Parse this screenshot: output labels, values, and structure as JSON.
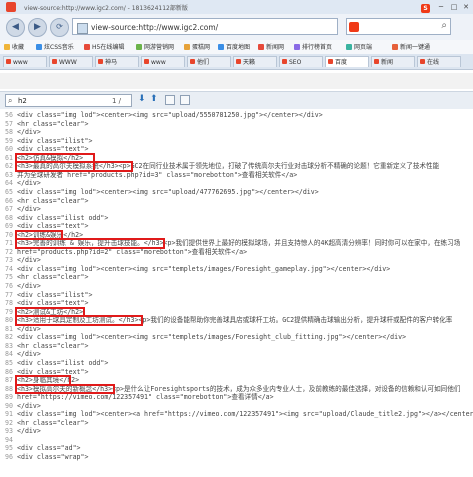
{
  "titlebar": {
    "title": "view-source:http://www.igc2.com/ - 1813624112部新版",
    "logo": "browser-logo-icon",
    "right_logo_text": "S",
    "window_buttons": [
      "─",
      "□",
      "✕"
    ]
  },
  "navbar": {
    "back": "◀",
    "forward": "▶",
    "address": "view-source:http://www.igc2.com/",
    "search_value": ""
  },
  "bookmarks": [
    {
      "label": "收藏",
      "color": "#f0b53a"
    },
    {
      "label": "炫CSS音乐",
      "color": "#3a8ee6"
    },
    {
      "label": "H5在线编辑",
      "color": "#e64a3a"
    },
    {
      "label": "网游营销网",
      "color": "#6bb34b"
    },
    {
      "label": "蛋糕网",
      "color": "#e6a23a"
    },
    {
      "label": "百度地图",
      "color": "#3a8ee6"
    },
    {
      "label": "新闻网",
      "color": "#e64a3a"
    },
    {
      "label": "排行榜首页",
      "color": "#8a6be6"
    },
    {
      "label": "网页端",
      "color": "#3ab3a0"
    },
    {
      "label": "新闻一键通",
      "color": "#e6603a"
    }
  ],
  "tabs": [
    {
      "label": "www",
      "active": false
    },
    {
      "label": "WWW",
      "active": false
    },
    {
      "label": "神马",
      "active": false
    },
    {
      "label": "www",
      "active": false
    },
    {
      "label": "他们",
      "active": false
    },
    {
      "label": "天籁",
      "active": false
    },
    {
      "label": "SEO",
      "active": false
    },
    {
      "label": "百度",
      "active": true
    },
    {
      "label": "新闻",
      "active": false
    },
    {
      "label": "在线",
      "active": false
    }
  ],
  "findbar": {
    "query": "h2",
    "count": "1 / 10"
  },
  "lines": [
    {
      "n": "56",
      "t": "<div class=\"img lod\"><center><img src=\"upload/5550781250.jpg\"></center></div>"
    },
    {
      "n": "57",
      "t": "<hr class=\"clear\">"
    },
    {
      "n": "58",
      "t": "</div>"
    },
    {
      "n": "59",
      "t": "<div class=\"ilist\">"
    },
    {
      "n": "60",
      "t": "<div class=\"text\">"
    },
    {
      "n": "61",
      "t": "<h2>仿真&模拟</h2>"
    },
    {
      "n": "62",
      "t": "<h3>最真的高尔夫模拟系统</h3><p>GC2在同行业技术属于领先地位，打破了传统高尔夫行业对击球分析不精确的论题！它重新定义了技术性能"
    },
    {
      "n": "63",
      "t": "并为全球研发者 href=\"products.php?id=3\" class=\"morebotton\">查看相关软件</a>"
    },
    {
      "n": "64",
      "t": "</div>"
    },
    {
      "n": "65",
      "t": "<div class=\"img lod\"><center><img src=\"upload/477762695.jpg\"></center></div>"
    },
    {
      "n": "66",
      "t": "<hr class=\"clear\">"
    },
    {
      "n": "67",
      "t": "</div>"
    },
    {
      "n": "68",
      "t": "<div class=\"ilist odd\">"
    },
    {
      "n": "69",
      "t": "<div class=\"text\">"
    },
    {
      "n": "70",
      "t": "<h2>训练&娱乐</h2>"
    },
    {
      "n": "71",
      "t": "<h3>完善的训练 & 娱乐，提升击球技能。</h3><p>我们提供世界上最好的模拟球场，并且支持惊人的4K超高清分辨率！同时你可以在家中，在练习场"
    },
    {
      "n": "72",
      "t": "href=\"products.php?id=2\" class=\"morebotton\">查看相关软件</a>"
    },
    {
      "n": "73",
      "t": "</div>"
    },
    {
      "n": "74",
      "t": "<div class=\"img lod\"><center><img src=\"templets/images/Foresight_gameplay.jpg\"></center></div>"
    },
    {
      "n": "75",
      "t": "<hr class=\"clear\">"
    },
    {
      "n": "76",
      "t": "</div>"
    },
    {
      "n": "77",
      "t": "<div class=\"ilist\">"
    },
    {
      "n": "78",
      "t": "<div class=\"text\">"
    },
    {
      "n": "79",
      "t": "<h2>测试&工坊</h2>"
    },
    {
      "n": "80",
      "t": "<h3>适用于球具定制及工坊测试。</h3><p>我们的设备能帮助你完善球具店或球杆工坊。GC2提供精确击球输出分析，提升球杆或配件的客户转化率"
    },
    {
      "n": "81",
      "t": "</div>"
    },
    {
      "n": "82",
      "t": "<div class=\"img lod\"><center><img src=\"templets/images/Foresight_club_fitting.jpg\"></center></div>"
    },
    {
      "n": "83",
      "t": "<hr class=\"clear\">"
    },
    {
      "n": "84",
      "t": "</div>"
    },
    {
      "n": "85",
      "t": "<div class=\"ilist odd\">"
    },
    {
      "n": "86",
      "t": "<div class=\"text\">"
    },
    {
      "n": "87",
      "t": "<h2>身临其境</h2>"
    },
    {
      "n": "88",
      "t": "<h3>模拟高尔夫的新概念</h3><p>是什么让Foresightsports的技术，成为众多业内专业人士，及前教练的最佳选择，对设备的信赖和认可如同他们"
    },
    {
      "n": "89",
      "t": "href=\"https://vimeo.com/122357491\" class=\"morebotton\">查看详情</a>"
    },
    {
      "n": "90",
      "t": "</div>"
    },
    {
      "n": "91",
      "t": "<div class=\"img lod\"><center><a href=\"https://vimeo.com/122357491\"><img src=\"upload/Claude_title2.jpg\"></a></center></div>"
    },
    {
      "n": "92",
      "t": "<hr class=\"clear\">"
    },
    {
      "n": "93",
      "t": "</div>"
    },
    {
      "n": "94",
      "t": ""
    },
    {
      "n": "95",
      "t": "<div class=\"ad\">"
    },
    {
      "n": "96",
      "t": "<div class=\"wrap\">"
    }
  ]
}
